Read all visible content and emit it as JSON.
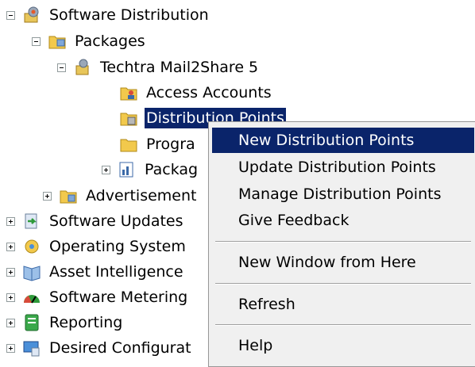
{
  "tree": {
    "software_distribution": "Software Distribution",
    "packages": "Packages",
    "package_name": "Techtra Mail2Share 5",
    "access_accounts": "Access Accounts",
    "distribution_points": "Distribution Points",
    "programs": "Progra",
    "package_status": "Packag",
    "advertisements": "Advertisement",
    "software_updates": "Software Updates",
    "operating_system": "Operating System",
    "asset_intelligence": "Asset Intelligence",
    "software_metering": "Software Metering",
    "reporting": "Reporting",
    "desired_configuration": "Desired Configurat"
  },
  "context_menu": {
    "items": [
      "New Distribution Points",
      "Update Distribution Points",
      "Manage Distribution Points",
      "Give Feedback",
      "New Window from Here",
      "Refresh",
      "Help"
    ],
    "highlighted": "New Distribution Points"
  },
  "colors": {
    "selection": "#0a246a",
    "menu_bg": "#f0f0f0"
  }
}
